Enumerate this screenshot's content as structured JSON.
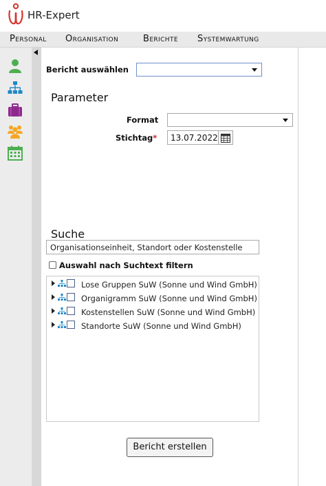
{
  "app": {
    "title": "HR-Expert"
  },
  "menu": [
    {
      "label": "Personal"
    },
    {
      "label": "Organisation"
    },
    {
      "label": "Berichte"
    },
    {
      "label": "Systemwartung"
    }
  ],
  "sidebar": [
    {
      "icon": "person-icon",
      "color": "#4caf50"
    },
    {
      "icon": "org-chart-icon",
      "color": "#1e88c7"
    },
    {
      "icon": "briefcase-icon",
      "color": "#8e2a8e"
    },
    {
      "icon": "group-icon",
      "color": "#f5a623"
    },
    {
      "icon": "calendar-icon",
      "color": "#4caf50"
    }
  ],
  "report": {
    "select_label": "Bericht auswählen",
    "selected_value": ""
  },
  "parameter": {
    "title": "Parameter",
    "format_label": "Format",
    "format_value": "",
    "stichtag_label": "Stichtag",
    "required_marker": "*",
    "stichtag_value": "13.07.2022"
  },
  "search": {
    "title": "Suche",
    "input_value": "Organisationseinheit, Standort oder Kostenstelle",
    "filter_label": "Auswahl nach Suchtext filtern",
    "filter_checked": false
  },
  "tree": {
    "items": [
      {
        "label": "Lose Gruppen SuW (Sonne und Wind GmbH)"
      },
      {
        "label": "Organigramm SuW (Sonne und Wind GmbH)"
      },
      {
        "label": "Kostenstellen SuW (Sonne und Wind GmbH)"
      },
      {
        "label": "Standorte SuW (Sonne und Wind GmbH)"
      }
    ]
  },
  "actions": {
    "create_report_label": "Bericht erstellen"
  },
  "colors": {
    "accent_red": "#d6342c",
    "select_border_blue": "#6e8fc9"
  }
}
